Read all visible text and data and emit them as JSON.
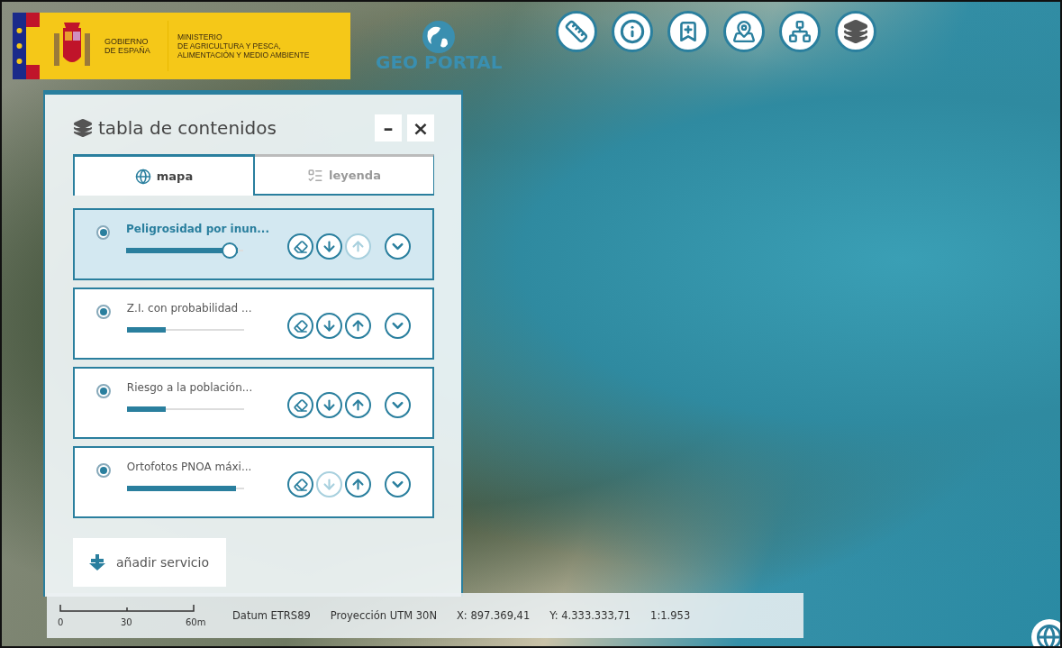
{
  "header": {
    "government": [
      "GOBIERNO",
      "DE ESPAÑA"
    ],
    "ministry": [
      "MINISTERIO",
      "DE AGRICULTURA Y PESCA,",
      "ALIMENTACIÓN Y MEDIO AMBIENTE"
    ],
    "portal": "GEO PORTAL"
  },
  "toolbar": [
    {
      "kind": "ruler"
    },
    {
      "kind": "info"
    },
    {
      "kind": "bookmark"
    },
    {
      "kind": "map"
    },
    {
      "kind": "tree"
    },
    {
      "kind": "layers"
    }
  ],
  "panel": {
    "title": "tabla de contenidos",
    "minimize": "–",
    "close": "×",
    "tabs": [
      {
        "label": "mapa",
        "kind": "globe",
        "selected": true
      },
      {
        "label": "leyenda",
        "kind": "legend",
        "selected": false
      }
    ],
    "layers": [
      {
        "name": "Peligrosidad por inun...",
        "checked": true,
        "selected": true,
        "level": 0.95,
        "erase_disabled": false,
        "download_disabled": false,
        "upload_disabled": true
      },
      {
        "name": "Z.I. con probabilidad ...",
        "checked": true,
        "selected": false,
        "level": 0.33,
        "erase_disabled": false,
        "download_disabled": false,
        "upload_disabled": false
      },
      {
        "name": "Riesgo a la población...",
        "checked": true,
        "selected": false,
        "level": 0.33,
        "erase_disabled": false,
        "download_disabled": false,
        "upload_disabled": false
      },
      {
        "name": "Ortofotos PNOA máxi...",
        "checked": true,
        "selected": false,
        "level": 0.93,
        "erase_disabled": false,
        "download_disabled": true,
        "upload_disabled": false
      }
    ],
    "add_service": "añadir servicio"
  },
  "status_bar": {
    "scale_labels": [
      "0",
      "30",
      "60m"
    ],
    "datum": "Datum ETRS89",
    "projection": "Proyección UTM 30N",
    "x": "X: 897.369,41",
    "y": "Y: 4.333.333,71",
    "scale": "1:1.953"
  }
}
